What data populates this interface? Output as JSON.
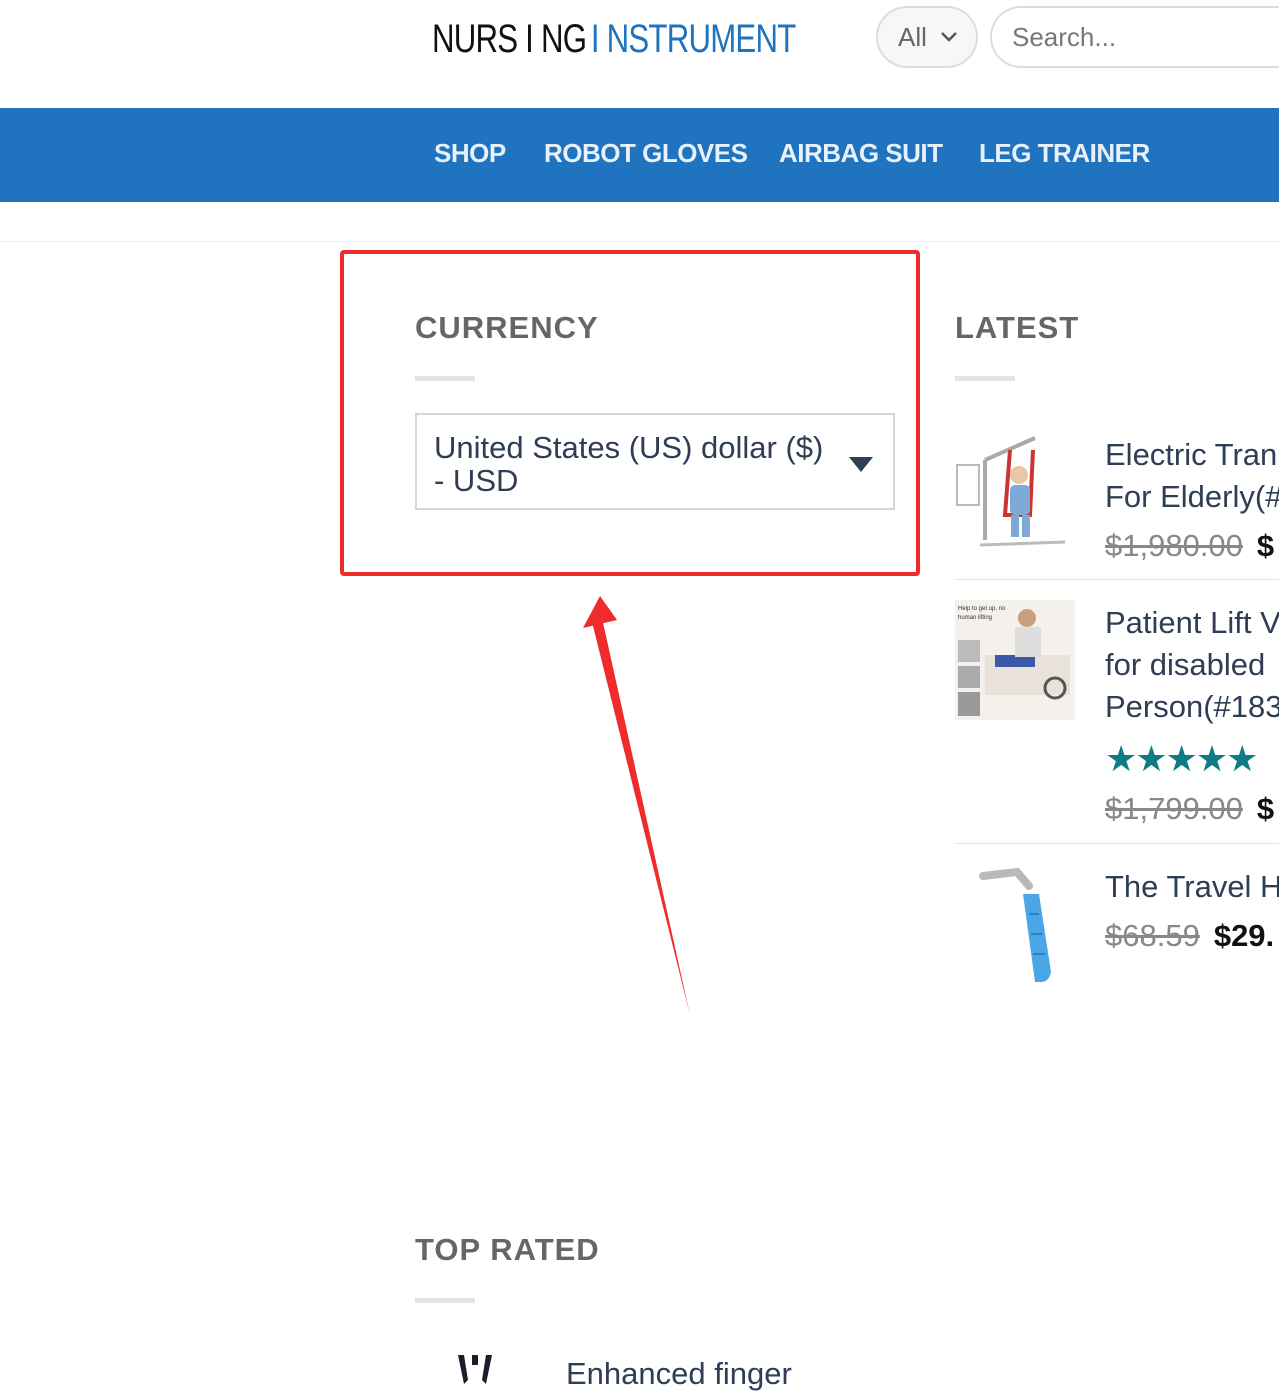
{
  "header": {
    "logo_part1": "NURS I NG",
    "logo_part2": "I NSTRUMENT",
    "category_select": "All",
    "search_placeholder": "Search..."
  },
  "nav": {
    "items": [
      "SHOP",
      "ROBOT GLOVES",
      "AIRBAG SUIT",
      "LEG TRAINER"
    ]
  },
  "currency_widget": {
    "title": "CURRENCY",
    "selected": "United States (US) dollar ($) - USD"
  },
  "latest_widget": {
    "title": "LATEST",
    "products": [
      {
        "title_line1": "Electric Tran",
        "title_line2": "For Elderly(#",
        "old_price": "$1,980.00",
        "new_price": "$"
      },
      {
        "title_line1": "Patient Lift V",
        "title_line2": "for disabled",
        "title_line3": "Person(#183",
        "rating": 5,
        "stars": "★★★★★",
        "old_price": "$1,799.00",
        "new_price": "$",
        "thumb_caption_1": "Help to get up, no",
        "thumb_caption_2": "human lifting"
      },
      {
        "title_line1": "The Travel H",
        "old_price": "$68.59",
        "new_price": "$29."
      }
    ]
  },
  "top_rated_widget": {
    "title": "TOP RATED",
    "first_item": "Enhanced finger"
  },
  "colors": {
    "nav_bg": "#1f73bf",
    "highlight": "#ef2b2b",
    "star": "#0e7b85"
  }
}
